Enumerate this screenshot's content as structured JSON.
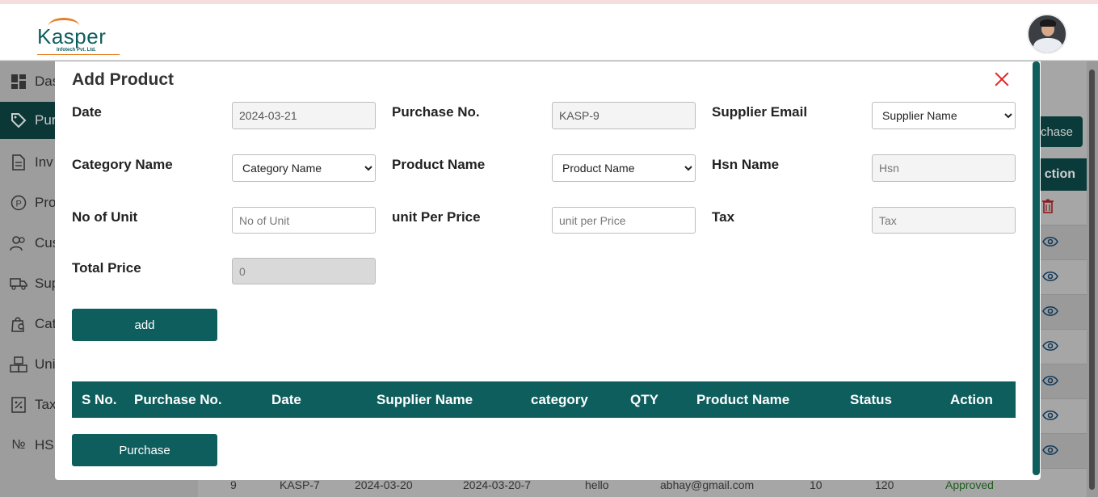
{
  "header": {
    "logo_text": "Kasper",
    "logo_sub": "Infotech Pvt. Ltd."
  },
  "sidebar": {
    "items": [
      {
        "label": "Das",
        "icon": "dashboard-icon"
      },
      {
        "label": "Pur",
        "icon": "tag-icon",
        "active": true
      },
      {
        "label": "Inv",
        "icon": "document-icon"
      },
      {
        "label": "Pro",
        "icon": "p-circle-icon"
      },
      {
        "label": "Cus",
        "icon": "users-icon"
      },
      {
        "label": "Sup",
        "icon": "truck-icon"
      },
      {
        "label": "Cat",
        "icon": "bag-search-icon"
      },
      {
        "label": "Uni",
        "icon": "boxes-icon"
      },
      {
        "label": "Tax",
        "icon": "tax-icon"
      },
      {
        "label": "HSN",
        "icon": "numero-icon",
        "icon_text": "№"
      }
    ]
  },
  "background": {
    "purchase_button": "chase",
    "action_header": "ction",
    "bottom_row": {
      "sno": "9",
      "purchase_no": "KASP-7",
      "date": "2024-03-20",
      "invoice": "2024-03-20-7",
      "category": "hello",
      "email": "abhay@gmail.com",
      "qty": "10",
      "price": "120",
      "status": "Approved"
    }
  },
  "modal": {
    "title": "Add Product",
    "fields": {
      "date": {
        "label": "Date",
        "value": "2024-03-21"
      },
      "purchase_no": {
        "label": "Purchase No.",
        "value": "KASP-9"
      },
      "supplier_email": {
        "label": "Supplier Email",
        "selected": "Supplier Name"
      },
      "category_name": {
        "label": "Category Name",
        "selected": "Category Name"
      },
      "product_name": {
        "label": "Product Name",
        "selected": "Product Name"
      },
      "hsn_name": {
        "label": "Hsn Name",
        "placeholder": "Hsn"
      },
      "no_of_unit": {
        "label": "No of Unit",
        "placeholder": "No of Unit"
      },
      "unit_per_price": {
        "label": "unit Per Price",
        "placeholder": "unit per Price"
      },
      "tax": {
        "label": "Tax",
        "placeholder": "Tax"
      },
      "total_price": {
        "label": "Total Price",
        "value": "0"
      }
    },
    "add_button": "add",
    "table": {
      "columns": [
        "S No.",
        "Purchase No.",
        "Date",
        "Supplier Name",
        "category",
        "QTY",
        "Product Name",
        "Status",
        "Action"
      ]
    },
    "purchase_button": "Purchase"
  },
  "colors": {
    "primary": "#0f5e5e",
    "close": "#e02424"
  }
}
